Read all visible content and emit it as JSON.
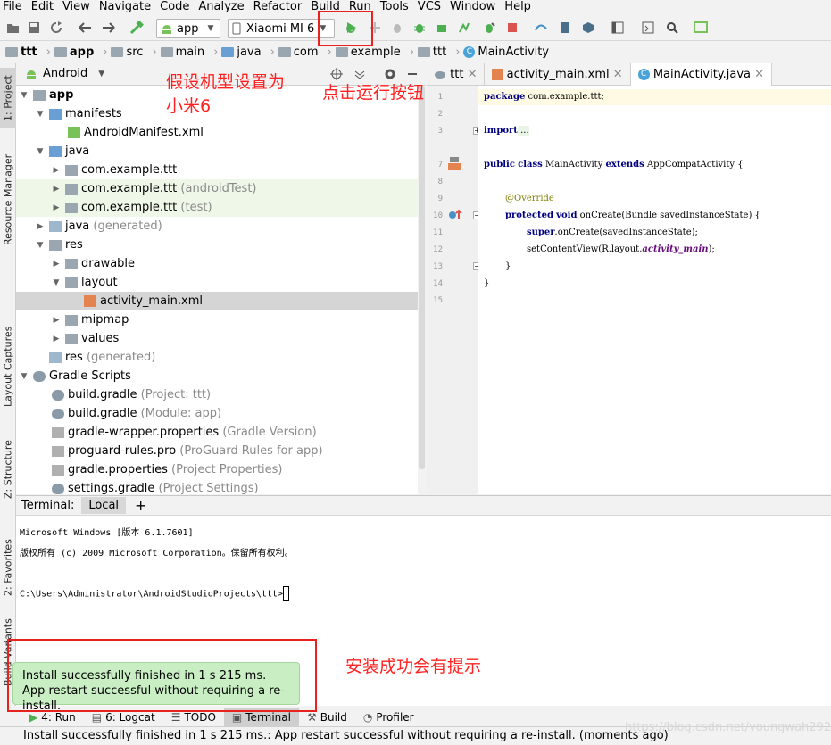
{
  "menu": [
    "File",
    "Edit",
    "View",
    "Navigate",
    "Code",
    "Analyze",
    "Refactor",
    "Build",
    "Run",
    "Tools",
    "VCS",
    "Window",
    "Help"
  ],
  "toolbar": {
    "config": "app",
    "device": "Xiaomi MI 6"
  },
  "breadcrumb": [
    "ttt",
    "app",
    "src",
    "main",
    "java",
    "com",
    "example",
    "ttt",
    "MainActivity"
  ],
  "project_panel": {
    "view": "Android"
  },
  "tree": [
    {
      "label": "app",
      "bold": true
    },
    {
      "label": "manifests"
    },
    {
      "label": "AndroidManifest.xml"
    },
    {
      "label": "java"
    },
    {
      "label": "com.example.ttt"
    },
    {
      "label": "com.example.ttt",
      "suffix": "(androidTest)"
    },
    {
      "label": "com.example.ttt",
      "suffix": "(test)"
    },
    {
      "label": "java",
      "suffix": "(generated)"
    },
    {
      "label": "res"
    },
    {
      "label": "drawable"
    },
    {
      "label": "layout"
    },
    {
      "label": "activity_main.xml"
    },
    {
      "label": "mipmap"
    },
    {
      "label": "values"
    },
    {
      "label": "res",
      "suffix": "(generated)"
    },
    {
      "label": "Gradle Scripts"
    },
    {
      "label": "build.gradle",
      "suffix": "(Project: ttt)"
    },
    {
      "label": "build.gradle",
      "suffix": "(Module: app)"
    },
    {
      "label": "gradle-wrapper.properties",
      "suffix": "(Gradle Version)"
    },
    {
      "label": "proguard-rules.pro",
      "suffix": "(ProGuard Rules for app)"
    },
    {
      "label": "gradle.properties",
      "suffix": "(Project Properties)"
    },
    {
      "label": "settings.gradle",
      "suffix": "(Project Settings)"
    }
  ],
  "editor_tabs": [
    "ttt",
    "activity_main.xml",
    "MainActivity.java"
  ],
  "line_numbers": [
    "1",
    "2",
    "3",
    "7",
    "8",
    "9",
    "10",
    "11",
    "12",
    "13",
    "14",
    "15"
  ],
  "code": {
    "l1_kw": "package",
    "l1_rest": " com.example.ttt;",
    "l3_kw": "import",
    "l3_rest": " ...",
    "l7_kw1": "public",
    "l7_kw2": "class",
    "l7_mid": " MainActivity ",
    "l7_kw3": "extends",
    "l7_rest": " AppCompatActivity {",
    "l9": "@Override",
    "l10_kw1": "protected",
    "l10_kw2": "void",
    "l10_rest": " onCreate(Bundle savedInstanceState) {",
    "l11_kw": "super",
    "l11_rest": ".onCreate(savedInstanceState);",
    "l12_pre": "setContentView(R.layout.",
    "l12_it": "activity_main",
    "l12_post": ");",
    "l13": "}",
    "l14": "}"
  },
  "terminal": {
    "title": "Terminal:",
    "tab": "Local",
    "plus": "+",
    "lines": [
      "Microsoft Windows [版本 6.1.7601]",
      "版权所有 (c) 2009 Microsoft Corporation。保留所有权利。",
      "C:\\Users\\Administrator\\AndroidStudioProjects\\ttt>"
    ]
  },
  "left_strip": [
    "1: Project",
    "Resource Manager",
    "Layout Captures",
    "Z: Structure",
    "2: Favorites",
    "Build Variants"
  ],
  "bottom_tools": [
    "4: Run",
    "6: Logcat",
    "TODO",
    "Terminal",
    "Build",
    "Profiler"
  ],
  "toast": {
    "line1": "Install successfully finished in 1 s 215 ms.",
    "line2": "App restart successful without requiring a re-install."
  },
  "status": "Install successfully finished in 1 s 215 ms.: App restart successful without requiring a re-install. (moments ago)",
  "annotations": {
    "device_note_1": "假设机型设置为",
    "device_note_2": "小米6",
    "run_note": "点击运行按钮",
    "success_note": "安装成功会有提示"
  },
  "watermark": "https://blog.csdn.net/youngwah292",
  "colors": {
    "annotation_red": "#e8231f",
    "toast_bg": "#c9eec4",
    "run_green": "#4caf50"
  }
}
